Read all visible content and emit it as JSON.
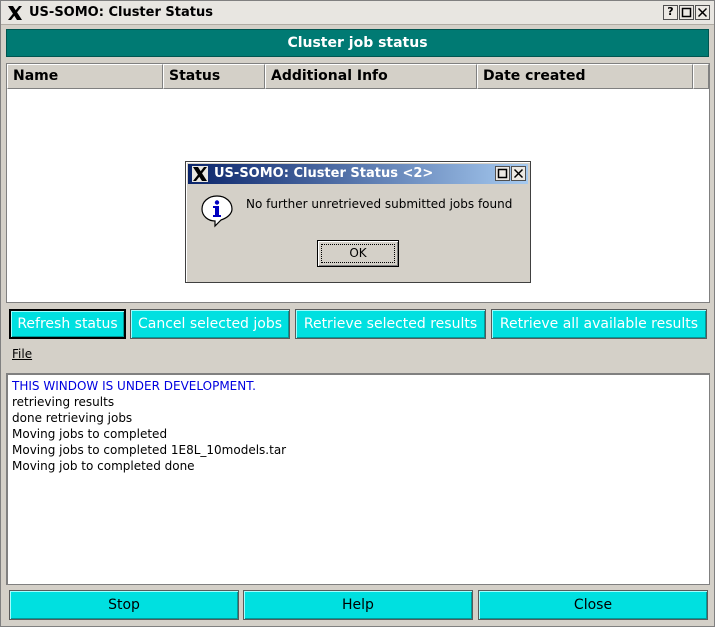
{
  "window": {
    "title": "US-SOMO: Cluster Status",
    "title_buttons": [
      "?",
      "",
      ""
    ]
  },
  "banner": {
    "text": "Cluster job status"
  },
  "table": {
    "columns": [
      "Name",
      "Status",
      "Additional Info",
      "Date created"
    ]
  },
  "actions": {
    "refresh": "Refresh status",
    "cancel": "Cancel selected jobs",
    "retrieve_selected": "Retrieve selected results",
    "retrieve_all": "Retrieve all available results"
  },
  "menu": {
    "file": "File"
  },
  "log": {
    "lines": [
      "THIS WINDOW IS UNDER DEVELOPMENT.",
      "retrieving results",
      "done retrieving jobs",
      "Moving jobs to completed",
      "Moving jobs to completed 1E8L_10models.tar",
      "Moving job to completed done"
    ]
  },
  "bottom": {
    "stop": "Stop",
    "help": "Help",
    "close": "Close"
  },
  "dialog": {
    "title": "US-SOMO: Cluster Status <2>",
    "message": "No further unretrieved submitted jobs found",
    "ok": "OK"
  },
  "colors": {
    "banner": "#007a73",
    "button_cyan": "#00e0e0",
    "dev_text": "#0000e0",
    "dialog_title_start": "#0a246a"
  }
}
